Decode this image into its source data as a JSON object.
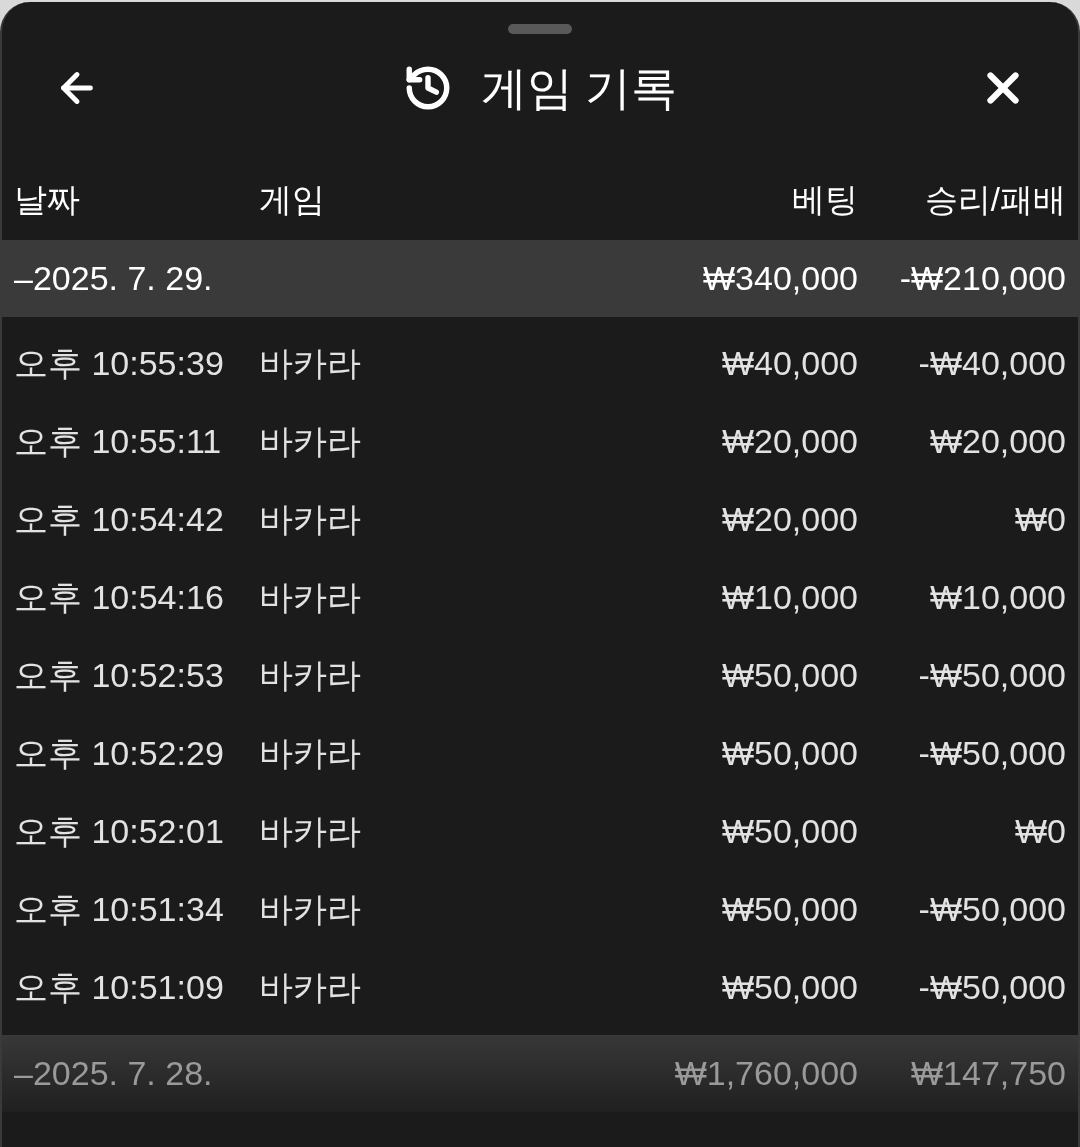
{
  "sheet": {
    "title": "게임 기록"
  },
  "columns": [
    "날짜",
    "게임",
    "베팅",
    "승리/패배"
  ],
  "groups": [
    {
      "date": "–2025. 7. 29.",
      "bet": "₩340,000",
      "result": "-₩210,000",
      "dimmed": false,
      "children": [
        {
          "time": "오후 10:55:39",
          "game": "바카라",
          "bet": "₩40,000",
          "result": "-₩40,000"
        },
        {
          "time": "오후 10:55:11",
          "game": "바카라",
          "bet": "₩20,000",
          "result": "₩20,000"
        },
        {
          "time": "오후 10:54:42",
          "game": "바카라",
          "bet": "₩20,000",
          "result": "₩0"
        },
        {
          "time": "오후 10:54:16",
          "game": "바카라",
          "bet": "₩10,000",
          "result": "₩10,000"
        },
        {
          "time": "오후 10:52:53",
          "game": "바카라",
          "bet": "₩50,000",
          "result": "-₩50,000"
        },
        {
          "time": "오후 10:52:29",
          "game": "바카라",
          "bet": "₩50,000",
          "result": "-₩50,000"
        },
        {
          "time": "오후 10:52:01",
          "game": "바카라",
          "bet": "₩50,000",
          "result": "₩0"
        },
        {
          "time": "오후 10:51:34",
          "game": "바카라",
          "bet": "₩50,000",
          "result": "-₩50,000"
        },
        {
          "time": "오후 10:51:09",
          "game": "바카라",
          "bet": "₩50,000",
          "result": "-₩50,000"
        }
      ]
    },
    {
      "date": "–2025. 7. 28.",
      "bet": "₩1,760,000",
      "result": "₩147,750",
      "dimmed": true
    }
  ]
}
